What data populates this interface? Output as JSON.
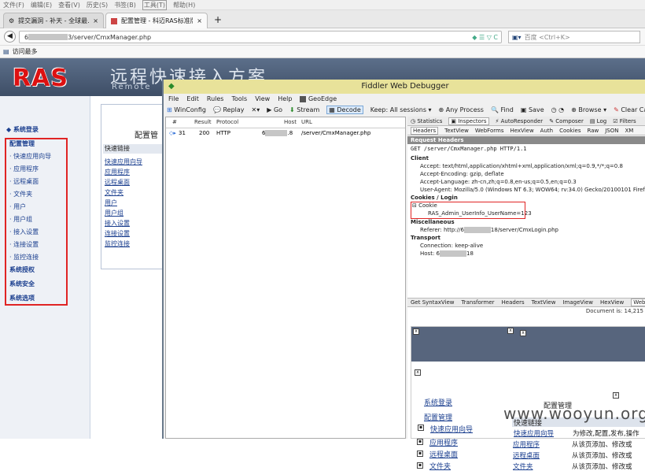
{
  "firefox": {
    "menu": [
      "文件(F)",
      "编辑(E)",
      "查看(V)",
      "历史(S)",
      "书签(B)",
      "工具(T)",
      "帮助(H)"
    ],
    "tabs": [
      {
        "label": "提交漏洞 - 补天 - 全球最...",
        "close": "×"
      },
      {
        "label": "配置管理 - 科迈RAS标准版服...",
        "close": "×"
      }
    ],
    "new_tab": "+",
    "url": "3/server/CmxManager.php",
    "url_prefix": "6",
    "search_placeholder": "百度 <Ctrl+K>",
    "bookmark": "访问最多"
  },
  "ras": {
    "logo": "RAS",
    "slogan": "远程快速接入方案",
    "slogan_sub": "Remote",
    "nav": {
      "login": "系统登录",
      "config": "配置管理",
      "items": [
        "快速应用向导",
        "应用程序",
        "远程桌面",
        "文件夹",
        "用户",
        "用户组",
        "接入设置",
        "连接设置",
        "监控连接"
      ],
      "auth": "系统授权",
      "security": "系统安全",
      "options": "系统选项"
    },
    "panel_title": "配置管",
    "quick_links_head": "快速链接",
    "quick_links": [
      "快速应用向导",
      "应用程序",
      "远程桌面",
      "文件夹",
      "用户",
      "用户组",
      "接入设置",
      "连接设置",
      "监控连接"
    ]
  },
  "fiddler": {
    "title": "Fiddler Web Debugger",
    "menu": [
      "File",
      "Edit",
      "Rules",
      "Tools",
      "View",
      "Help",
      "GeoEdge"
    ],
    "toolbar": [
      "WinConfig",
      "Replay",
      "Go",
      "Stream",
      "Decode",
      "Keep: All sessions",
      "Any Process",
      "Find",
      "Save",
      "Browse",
      "Clear Cache"
    ],
    "columns": [
      "#",
      "Result",
      "Protocol",
      "Host",
      "URL"
    ],
    "session": {
      "id": "31",
      "result": "200",
      "protocol": "HTTP",
      "host_prefix": "6",
      "host_suffix": ".8",
      "url": "/server/CmxManager.php"
    },
    "tabs_top": [
      "Statistics",
      "Inspectors",
      "AutoResponder",
      "Composer",
      "Log",
      "Filters"
    ],
    "tabs_req": [
      "Headers",
      "TextView",
      "WebForms",
      "HexView",
      "Auth",
      "Cookies",
      "Raw",
      "JSON",
      "XM"
    ],
    "req_title": "Request Headers",
    "req_line": "GET /server/CmxManager.php HTTP/1.1",
    "client": "Client",
    "client_headers": [
      "Accept: text/html,application/xhtml+xml,application/xml;q=0.9,*/*;q=0.8",
      "Accept-Encoding: gzip, deflate",
      "Accept-Language: zh-cn,zh;q=0.8,en-us;q=0.5,en;q=0.3",
      "User-Agent: Mozilla/5.0 (Windows NT 6.3; WOW64; rv:34.0) Gecko/20100101 Firefox/34.0"
    ],
    "cookies_section": "Cookies / Login",
    "cookie_label": "Cookie",
    "cookie_value": "RAS_Admin_UserInfo_UserName=123",
    "misc_section": "Miscellaneous",
    "referer_prefix": "Referer: http://6",
    "referer_suffix": "18/server/CmxLogin.php",
    "transport_section": "Transport",
    "connection": "Connection: keep-alive",
    "host_prefix": "Host: 6",
    "host_suffix": "18",
    "tabs_resp": [
      "Get SyntaxView",
      "Transformer",
      "Headers",
      "TextView",
      "ImageView",
      "HexView",
      "WebView"
    ],
    "doc_size": "Document is: 14,215",
    "webview": {
      "login": "系统登录",
      "config": "配置管理",
      "title": "配置管理",
      "links": [
        "快速应用向导",
        "应用程序",
        "远程桌面",
        "文件夹"
      ],
      "quick_head": "快速链接",
      "rows": [
        {
          "link": "快速应用向导",
          "desc": "为修改,配置,发布,操作"
        },
        {
          "link": "应用程序",
          "desc": "从该页添加、修改或"
        },
        {
          "link": "远程桌面",
          "desc": "从该页添加、修改或"
        },
        {
          "link": "文件夹",
          "desc": "从该页添加、修改或"
        }
      ]
    }
  },
  "watermark": "www.wooyun.org",
  "colors": {
    "highlight_red": "#e02424",
    "fiddler_title": "#e8e29a",
    "link_blue": "#1b3f8f"
  }
}
